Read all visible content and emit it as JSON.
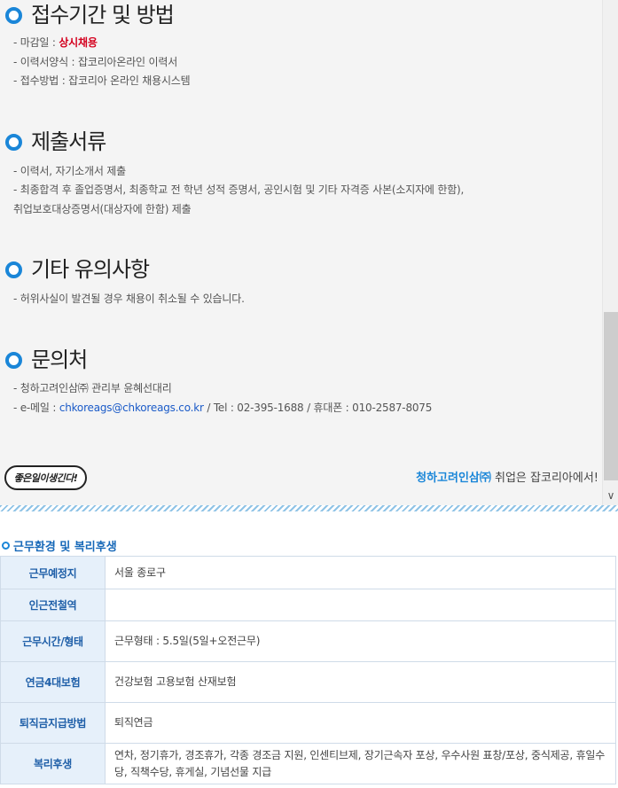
{
  "sections": [
    {
      "title": "접수기간 및 방법",
      "lines": [
        {
          "prefix": "- 마감일 : ",
          "highlight": "상시채용"
        },
        {
          "text": "- 이력서양식 : 잡코리아온라인 이력서"
        },
        {
          "text": "- 접수방법 : 잡코리아 온라인 채용시스템"
        }
      ]
    },
    {
      "title": "제출서류",
      "lines": [
        {
          "text": "- 이력서, 자기소개서 제출"
        },
        {
          "text": "- 최종합격 후 졸업증명서, 최종학교 전 학년 성적 증명서, 공인시험 및 기타 자격증 사본(소지자에 한함),"
        },
        {
          "text": "취업보호대상증명서(대상자에 한함) 제출"
        }
      ]
    },
    {
      "title": "기타 유의사항",
      "lines": [
        {
          "text": "- 허위사실이 발견될 경우 채용이 취소될 수 있습니다."
        }
      ]
    },
    {
      "title": "문의처",
      "lines": [
        {
          "text": "- 청하고려인삼㈜ 관리부 윤혜선대리"
        },
        {
          "prefix": "- e-메일 : ",
          "email": "chkoreags@chkoreags.co.kr",
          "suffix": " / Tel : 02-395-1688 / 휴대폰 : 010-2587-8075"
        }
      ]
    }
  ],
  "stamp_text": "좋은일이생긴다!",
  "footer": {
    "brand": "청하고려인삼㈜",
    "text": " 취업은 잡코리아에서!"
  },
  "work_env": {
    "title": "근무환경 및 복리후생",
    "rows": [
      {
        "label": "근무예정지",
        "value": "서울 종로구"
      },
      {
        "label": "인근전철역",
        "value": ""
      },
      {
        "label": "근무시간/형태",
        "value": "근무형태 : 5.5일(5일+오전근무)"
      },
      {
        "label": "연금4대보험",
        "value": "건강보험 고용보험 산재보험"
      },
      {
        "label": "퇴직금지급방법",
        "value": "퇴직연금"
      },
      {
        "label": "복리후생",
        "value": "연차, 정기휴가, 경조휴가, 각종 경조금 지원, 인센티브제, 장기근속자 포상, 우수사원 표창/포상, 중식제공, 휴일수당, 직책수당, 휴게실, 기념선물 지급"
      }
    ]
  }
}
